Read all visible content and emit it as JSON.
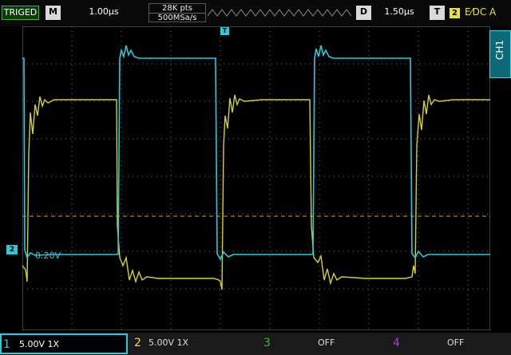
{
  "status": {
    "trigger_state": "TRIGED"
  },
  "horizontal": {
    "menu_key": "M",
    "timebase": "1.00μs"
  },
  "memory": {
    "points": "28K pts",
    "sample_rate": "500MSa/s"
  },
  "delay": {
    "menu_key": "D",
    "value": "1.50μs"
  },
  "trigger": {
    "menu_key": "T",
    "source": "2",
    "settings": "E⁄DC A",
    "marker": "T",
    "level_marker_color": "#e8a020"
  },
  "channels": [
    {
      "id": "1",
      "scale": "5.00V 1X",
      "color": "#2ec8d8",
      "active": true
    },
    {
      "id": "2",
      "scale": "5.00V 1X",
      "color": "#e8e23a",
      "active": true
    },
    {
      "id": "3",
      "scale": "OFF",
      "color": "#3cb43c",
      "active": false
    },
    {
      "id": "4",
      "scale": "OFF",
      "color": "#a040d0",
      "active": false
    }
  ],
  "ch1_tab": "CH1",
  "ground_marker": {
    "channel": "2",
    "offset_label": "0.20V"
  }
}
